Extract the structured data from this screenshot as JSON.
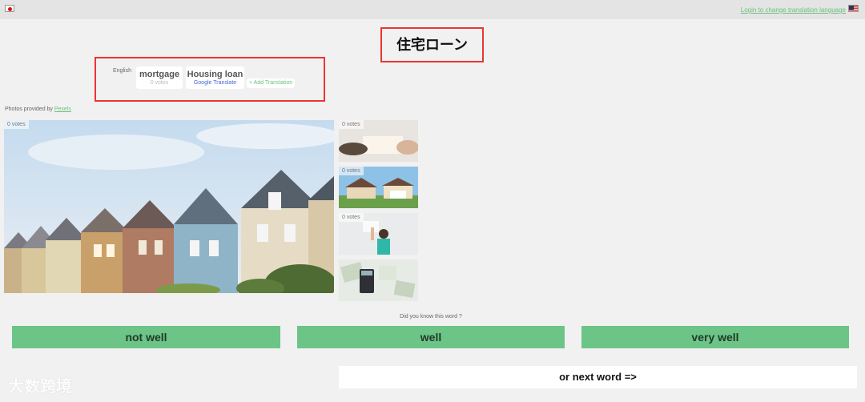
{
  "topbar": {
    "login_link": "Login to change translation language",
    "left_flag_icon": "japan-flag-icon",
    "right_flag_icon": "us-flag-icon"
  },
  "word": {
    "title": "住宅ローン"
  },
  "translations": {
    "language_label": "English",
    "items": [
      {
        "text": "mortgage",
        "sub": "0 votes"
      },
      {
        "text": "Housing loan",
        "sub": "Google Translate"
      }
    ],
    "add_label": "+ Add Translation"
  },
  "photos": {
    "credit_prefix": "Photos provided by ",
    "credit_link": "Pexels",
    "main_votes": "0 votes",
    "thumbs": [
      {
        "votes": "0 votes"
      },
      {
        "votes": "0 votes"
      },
      {
        "votes": "0 votes"
      },
      {
        "votes": ""
      }
    ]
  },
  "quiz": {
    "question": "Did you know this word ?",
    "not_well": "not well",
    "well": "well",
    "very_well": "very well",
    "next": "or next word =>"
  },
  "watermark": "大数跨境",
  "colors": {
    "accent": "#6cc487",
    "link": "#6cc081",
    "highlight_border": "#e33333"
  }
}
